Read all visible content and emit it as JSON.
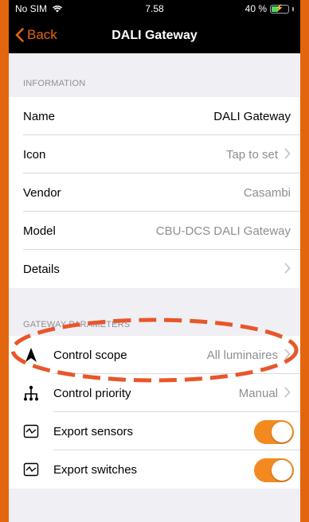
{
  "status": {
    "carrier": "No SIM",
    "time": "7.58",
    "battery": "40 %",
    "battery_level": 0.4
  },
  "nav": {
    "back_label": "Back",
    "title": "DALI Gateway"
  },
  "information": {
    "header": "INFORMATION",
    "rows": [
      {
        "label": "Name",
        "value": "DALI Gateway",
        "chevron": false
      },
      {
        "label": "Icon",
        "value": "Tap to set",
        "chevron": true
      },
      {
        "label": "Vendor",
        "value": "Casambi",
        "chevron": false
      },
      {
        "label": "Model",
        "value": "CBU-DCS DALI Gateway",
        "chevron": false
      },
      {
        "label": "Details",
        "value": "",
        "chevron": true
      }
    ]
  },
  "gateway": {
    "header": "GATEWAY PARAMETERS",
    "rows": [
      {
        "label": "Control scope",
        "value": "All luminaires",
        "icon": "navigation-arrow-icon"
      },
      {
        "label": "Control priority",
        "value": "Manual",
        "icon": "priority-tree-icon"
      },
      {
        "label": "Export sensors",
        "toggle": true,
        "icon": "sensor-graph-icon"
      },
      {
        "label": "Export switches",
        "toggle": true,
        "icon": "switch-graph-icon"
      }
    ]
  },
  "colors": {
    "accent": "#e3660f",
    "toggle_on": "#f28a1f",
    "background": "#efeff4",
    "highlight": "#e8562a"
  }
}
